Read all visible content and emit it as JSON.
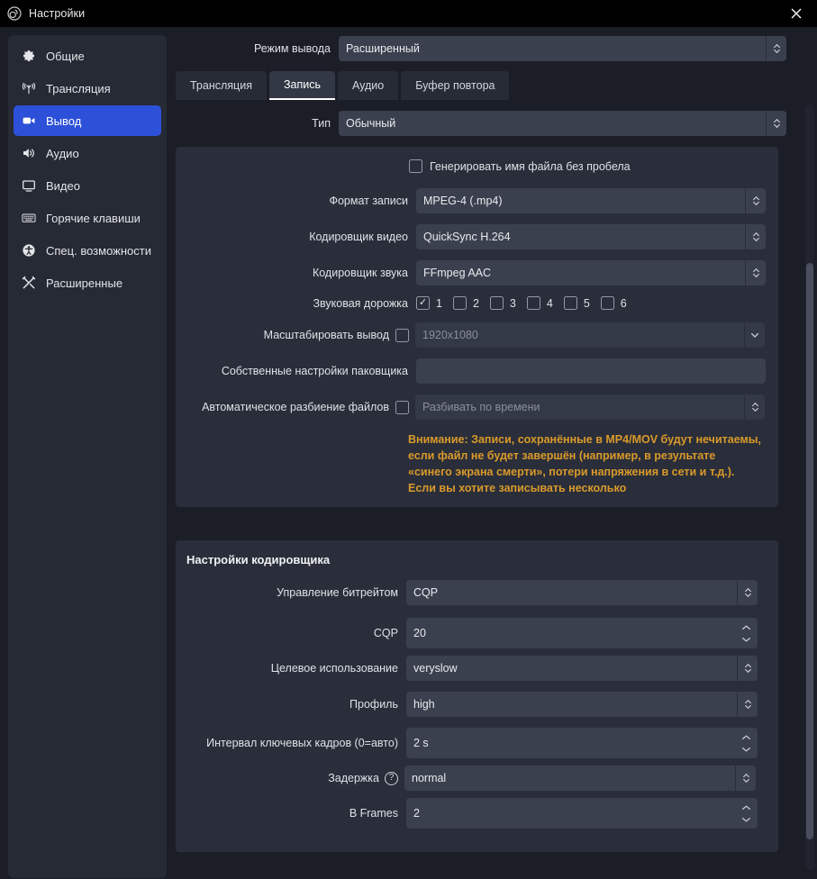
{
  "window": {
    "title": "Настройки",
    "logo_icon": "obs-logo-icon",
    "close_icon": "close-icon"
  },
  "sidebar": {
    "items": [
      {
        "label": "Общие",
        "icon": "gear-icon",
        "active": false
      },
      {
        "label": "Трансляция",
        "icon": "broadcast-icon",
        "active": false
      },
      {
        "label": "Вывод",
        "icon": "output-icon",
        "active": true
      },
      {
        "label": "Аудио",
        "icon": "speaker-icon",
        "active": false
      },
      {
        "label": "Видео",
        "icon": "monitor-icon",
        "active": false
      },
      {
        "label": "Горячие клавиши",
        "icon": "keyboard-icon",
        "active": false
      },
      {
        "label": "Спец. возможности",
        "icon": "accessibility-icon",
        "active": false
      },
      {
        "label": "Расширенные",
        "icon": "tools-icon",
        "active": false
      }
    ]
  },
  "output_mode": {
    "label": "Режим вывода",
    "value": "Расширенный"
  },
  "tabs": [
    {
      "label": "Трансляция",
      "active": false
    },
    {
      "label": "Запись",
      "active": true
    },
    {
      "label": "Аудио",
      "active": false
    },
    {
      "label": "Буфер повтора",
      "active": false
    }
  ],
  "type_row": {
    "label": "Тип",
    "value": "Обычный"
  },
  "recording": {
    "no_space_checkbox": {
      "label": "Генерировать имя файла без пробела",
      "checked": false
    },
    "format": {
      "label": "Формат записи",
      "value": "MPEG-4 (.mp4)"
    },
    "video_encoder": {
      "label": "Кодировщик видео",
      "value": "QuickSync H.264"
    },
    "audio_encoder": {
      "label": "Кодировщик звука",
      "value": "FFmpeg AAC"
    },
    "audio_track": {
      "label": "Звуковая дорожка",
      "tracks": [
        {
          "num": "1",
          "checked": true
        },
        {
          "num": "2",
          "checked": false
        },
        {
          "num": "3",
          "checked": false
        },
        {
          "num": "4",
          "checked": false
        },
        {
          "num": "5",
          "checked": false
        },
        {
          "num": "6",
          "checked": false
        }
      ]
    },
    "rescale": {
      "label": "Масштабировать вывод",
      "checked": false,
      "value": "1920x1080",
      "disabled": true
    },
    "muxer": {
      "label": "Собственные настройки паковщика",
      "value": ""
    },
    "auto_split": {
      "label": "Автоматическое разбиение файлов",
      "checked": false,
      "value": "Разбивать по времени",
      "disabled": true
    },
    "warning": "Внимание: Записи, сохранённые в MP4/MOV будут нечитаемы, если файл не будет завершён (например, в результате «синего экрана смерти», потери напряжения в сети и т.д.). Если вы хотите записывать несколько"
  },
  "encoder_settings": {
    "title": "Настройки кодировщика",
    "fields": [
      {
        "label": "Управление битрейтом",
        "value": "CQP",
        "widget": "combo"
      },
      {
        "label": "CQP",
        "value": "20",
        "widget": "spin"
      },
      {
        "label": "Целевое использование",
        "value": "veryslow",
        "widget": "combo"
      },
      {
        "label": "Профиль",
        "value": "high",
        "widget": "combo"
      },
      {
        "label": "Интервал ключевых кадров (0=авто)",
        "value": "2 s",
        "widget": "spin"
      },
      {
        "label": "Задержка",
        "value": "normal",
        "widget": "combo",
        "help": true
      },
      {
        "label": "B Frames",
        "value": "2",
        "widget": "spin"
      }
    ]
  },
  "colors": {
    "accent": "#2d50d8",
    "warning": "#d99a2b",
    "panel": "#2a2e3a",
    "field": "#3b404e",
    "window": "#1b1e27"
  }
}
